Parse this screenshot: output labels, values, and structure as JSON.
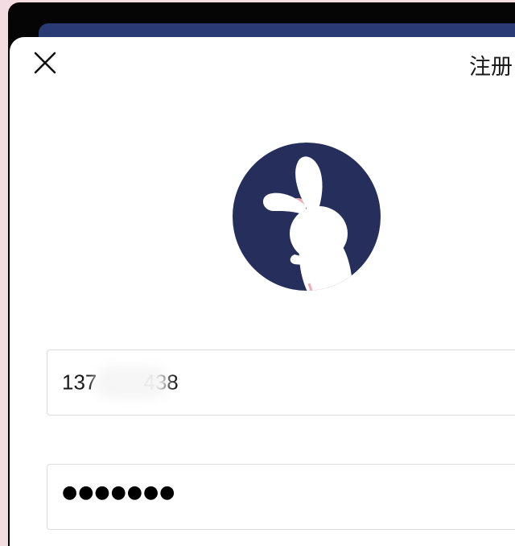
{
  "header": {
    "close_icon": "close-icon",
    "action_label": "注册"
  },
  "logo": {
    "icon": "rabbit-logo-icon",
    "circle_color": "#262f5c",
    "accent_color": "#f0a9b8"
  },
  "form": {
    "phone": {
      "value_prefix": "137",
      "value_suffix": "438"
    },
    "password": {
      "masked_value": "●●●●●●●"
    }
  },
  "colors": {
    "sheet_bg": "#ffffff",
    "backdrop_blue": "#2a3a72",
    "page_pink": "#f3dde3",
    "bezel": "#050505"
  }
}
